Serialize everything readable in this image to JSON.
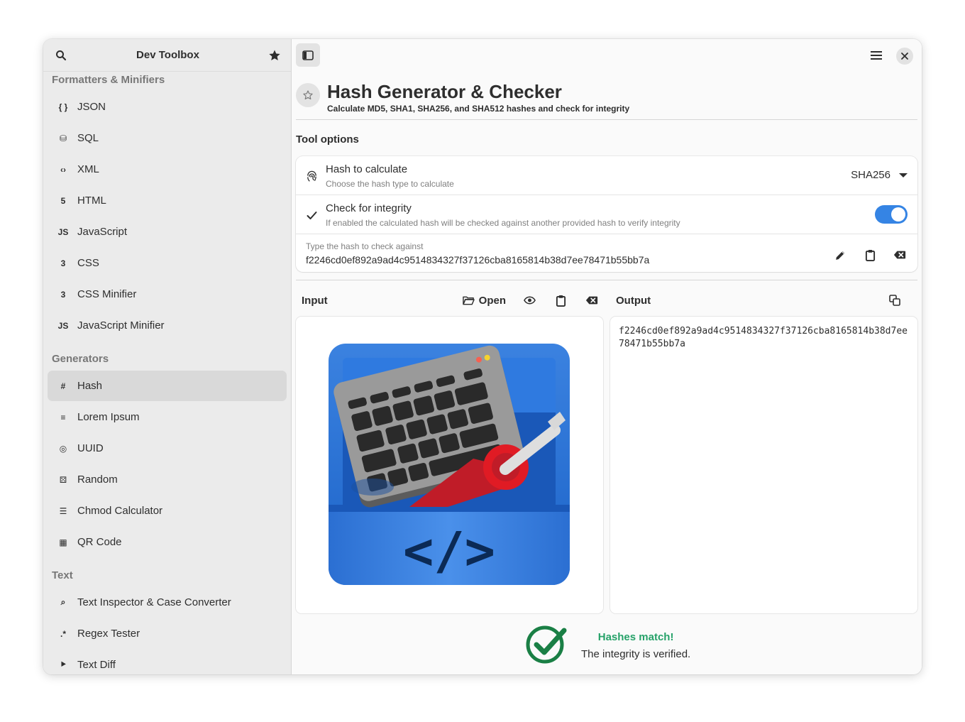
{
  "sidebar": {
    "title": "Dev Toolbox",
    "sections": [
      {
        "title": "Formatters & Minifiers",
        "items": [
          {
            "label": "JSON",
            "icon": "json-braces-icon"
          },
          {
            "label": "SQL",
            "icon": "database-icon"
          },
          {
            "label": "XML",
            "icon": "code-brackets-icon"
          },
          {
            "label": "HTML",
            "icon": "html5-icon"
          },
          {
            "label": "JavaScript",
            "icon": "js-icon"
          },
          {
            "label": "CSS",
            "icon": "css3-icon"
          },
          {
            "label": "CSS Minifier",
            "icon": "css3-icon"
          },
          {
            "label": "JavaScript Minifier",
            "icon": "js-icon"
          }
        ]
      },
      {
        "title": "Generators",
        "items": [
          {
            "label": "Hash",
            "icon": "hash-icon",
            "active": true
          },
          {
            "label": "Lorem Ipsum",
            "icon": "document-text-icon"
          },
          {
            "label": "UUID",
            "icon": "fingerprint-icon"
          },
          {
            "label": "Random",
            "icon": "dice-icon"
          },
          {
            "label": "Chmod Calculator",
            "icon": "permissions-icon"
          },
          {
            "label": "QR Code",
            "icon": "qr-code-icon"
          }
        ]
      },
      {
        "title": "Text",
        "items": [
          {
            "label": "Text Inspector & Case Converter",
            "icon": "text-inspect-icon"
          },
          {
            "label": "Regex Tester",
            "icon": "regex-icon"
          },
          {
            "label": "Text Diff",
            "icon": "diff-icon"
          }
        ]
      }
    ]
  },
  "tool": {
    "title": "Hash Generator & Checker",
    "subtitle": "Calculate MD5, SHA1, SHA256, and SHA512 hashes and check for integrity"
  },
  "options": {
    "title": "Tool options",
    "hash_type": {
      "title": "Hash to calculate",
      "subtitle": "Choose the hash type to calculate",
      "value": "SHA256"
    },
    "integrity": {
      "title": "Check for integrity",
      "subtitle": "If enabled the calculated hash will be checked against another provided hash to verify integrity",
      "enabled": true
    },
    "check_hash": {
      "label": "Type the hash to check against",
      "value": "f2246cd0ef892a9ad4c9514834327f37126cba8165814b38d7ee78471b55bb7a"
    }
  },
  "input": {
    "label": "Input",
    "open_label": "Open"
  },
  "output": {
    "label": "Output",
    "value": "f2246cd0ef892a9ad4c9514834327f37126cba8165814b38d7ee78471b55bb7a"
  },
  "status": {
    "title": "Hashes match!",
    "message": "The integrity is verified."
  },
  "colors": {
    "accent": "#3584e4",
    "success": "#26a269",
    "sidebar_bg": "#ebebeb"
  }
}
